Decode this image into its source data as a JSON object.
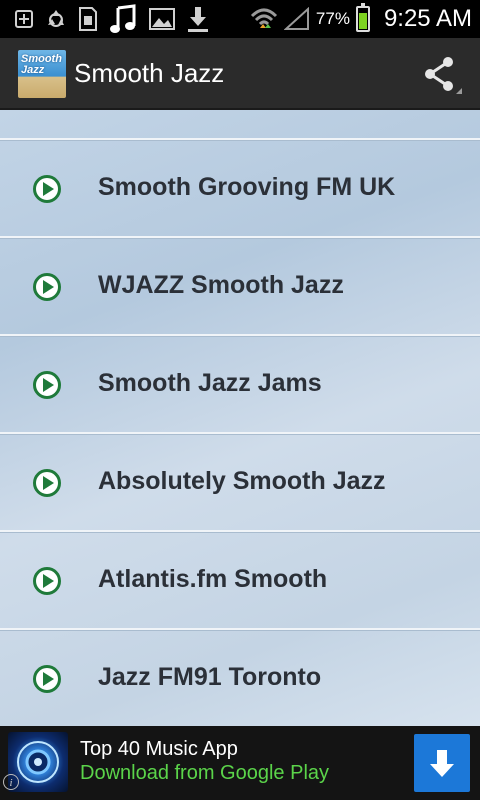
{
  "status_bar": {
    "battery_percent": "77%",
    "time": "9:25 AM",
    "icons": [
      "add-icon",
      "recycle-icon",
      "sd-card-icon",
      "music-note-icon",
      "image-icon",
      "download-icon",
      "wifi-icon",
      "signal-icon",
      "battery-icon"
    ]
  },
  "action_bar": {
    "app_icon_text": "Smooth Jazz",
    "title": "Smooth Jazz",
    "share_icon": "share-icon"
  },
  "stations": [
    {
      "label": "Smooth Grooving FM UK"
    },
    {
      "label": "WJAZZ Smooth Jazz"
    },
    {
      "label": "Smooth Jazz Jams"
    },
    {
      "label": "Absolutely Smooth Jazz"
    },
    {
      "label": "Atlantis.fm Smooth"
    },
    {
      "label": "Jazz FM91 Toronto"
    }
  ],
  "ad": {
    "title": "Top 40 Music App",
    "subtitle": "Download from Google Play",
    "info_icon": "i",
    "colors": {
      "subtitle": "#5bd44a",
      "button": "#1c78d8"
    }
  },
  "colors": {
    "play_icon": "#1f7a3a",
    "station_text": "#2b3038",
    "action_bar": "#2b2b2b"
  }
}
